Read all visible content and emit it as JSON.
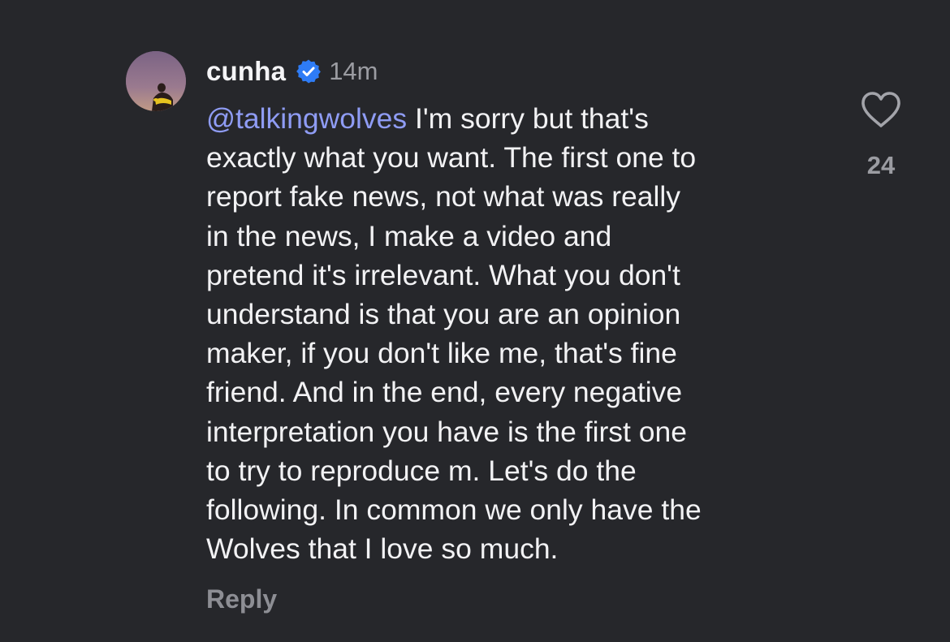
{
  "comment": {
    "username": "cunha",
    "verified": true,
    "time": "14m",
    "mention": "@talkingwolves",
    "lines": [
      " I'm sorry but that's",
      "exactly what you want. The first one to",
      "report fake news, not what was really",
      "in the news, I make a video and",
      "pretend it's irrelevant. What you don't",
      "understand is that you are an opinion",
      "maker, if you don't like me, that's fine",
      "friend. And in the end, every negative",
      "interpretation you have is the first one",
      "to try to reproduce m. Let's do the",
      "following. In common we only have the",
      "Wolves that I love so much."
    ],
    "reply_label": "Reply",
    "like_count": "24",
    "like_icon": "heart-outline-icon",
    "verified_icon": "verified-badge-icon"
  },
  "colors": {
    "background": "#26272b",
    "text": "#f2f2f4",
    "mention": "#8f9cf4",
    "secondary": "#9b9ca2",
    "verified": "#2e7cf6"
  }
}
